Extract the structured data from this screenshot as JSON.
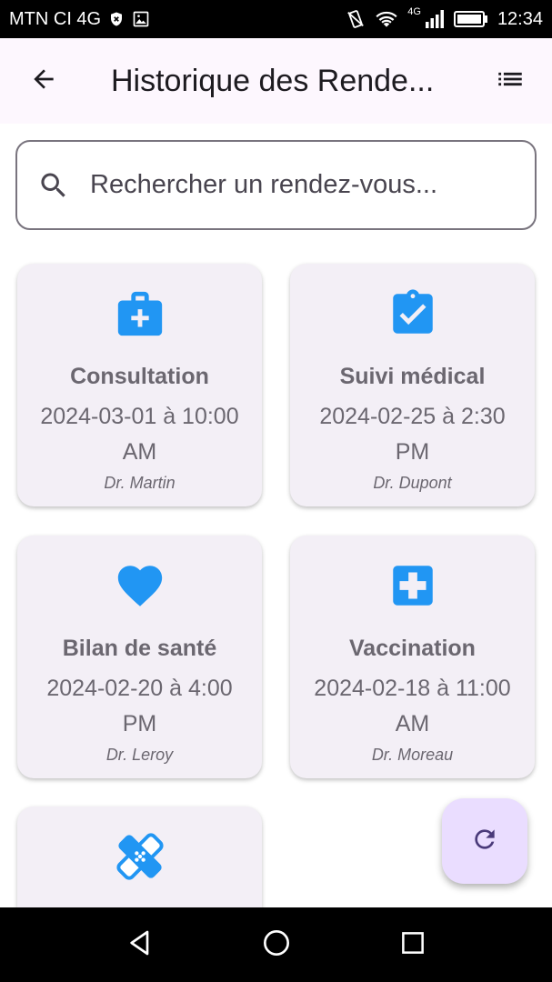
{
  "status_bar": {
    "carrier": "MTN CI 4G",
    "network_type": "4G",
    "time": "12:34"
  },
  "app_bar": {
    "title": "Historique des Rende..."
  },
  "search": {
    "placeholder": "Rechercher un rendez-vous..."
  },
  "appointments": [
    {
      "icon": "medical-bag-icon",
      "title": "Consultation",
      "date": "2024-03-01 à 10:00 AM",
      "doctor": "Dr. Martin"
    },
    {
      "icon": "clipboard-check-icon",
      "title": "Suivi médical",
      "date": "2024-02-25 à 2:30 PM",
      "doctor": "Dr. Dupont"
    },
    {
      "icon": "heart-icon",
      "title": "Bilan de santé",
      "date": "2024-02-20 à 4:00 PM",
      "doctor": "Dr. Leroy"
    },
    {
      "icon": "medical-cross-icon",
      "title": "Vaccination",
      "date": "2024-02-18 à 11:00 AM",
      "doctor": "Dr. Moreau"
    },
    {
      "icon": "bandage-icon"
    }
  ],
  "colors": {
    "accent": "#2196f3",
    "app_bar_bg": "#fdf7fe",
    "card_bg": "#f3eff6",
    "fab_bg": "#eaddff",
    "fab_icon": "#4a3a7a",
    "text_muted": "#6b6770"
  }
}
